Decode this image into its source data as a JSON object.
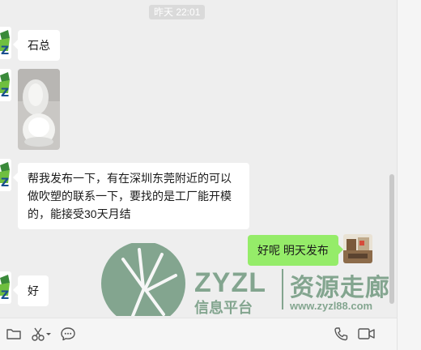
{
  "chat": {
    "timestamp": "昨天 22:01",
    "messages": [
      {
        "side": "left",
        "type": "text",
        "text": "石总"
      },
      {
        "side": "left",
        "type": "image"
      },
      {
        "side": "left",
        "type": "text",
        "text": "帮我发布一下，有在深圳东莞附近的可以做吹塑的联系一下，要找的是工厂能开模的，能接受30天月结"
      },
      {
        "side": "right",
        "type": "text",
        "text": "好呢 明天发布"
      },
      {
        "side": "left",
        "type": "text",
        "text": "好"
      }
    ]
  },
  "toolbar": {
    "left_tools": [
      "folder-icon",
      "scissors-icon",
      "chat-bubble-icon"
    ],
    "right_tools": [
      "phone-icon",
      "video-camera-icon"
    ]
  },
  "watermark": {
    "latin": "ZYZL",
    "cjk_big": "资源走廊",
    "cjk_small": "信息平台",
    "url": "www.zyzl88.com"
  },
  "colors": {
    "chat_bg": "#eeeeee",
    "bubble_self": "#95ec69",
    "bubble_other": "#ffffff",
    "watermark": "#2c6b43"
  }
}
